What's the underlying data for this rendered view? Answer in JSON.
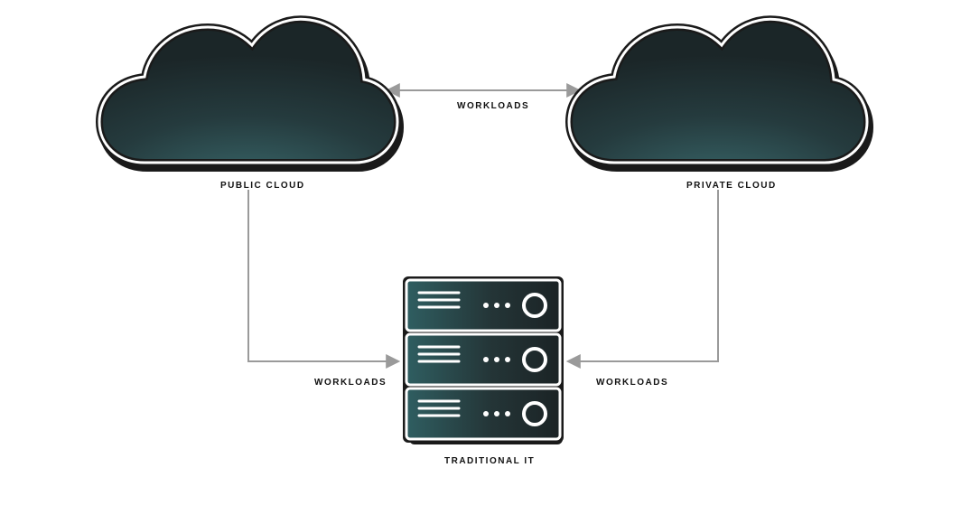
{
  "nodes": {
    "public_cloud": {
      "label": "PUBLIC CLOUD"
    },
    "private_cloud": {
      "label": "PRIVATE CLOUD"
    },
    "traditional_it": {
      "label": "TRADITIONAL IT"
    }
  },
  "edges": {
    "public_private": {
      "label": "WORKLOADS"
    },
    "public_to_traditional": {
      "label": "WORKLOADS"
    },
    "private_to_traditional": {
      "label": "WORKLOADS"
    }
  },
  "colors": {
    "fill_dark": "#1e3033",
    "fill_teal": "#2f5e61",
    "outline": "#ffffff",
    "shadow": "#1a1a1a",
    "arrow": "#9a9a9a"
  }
}
